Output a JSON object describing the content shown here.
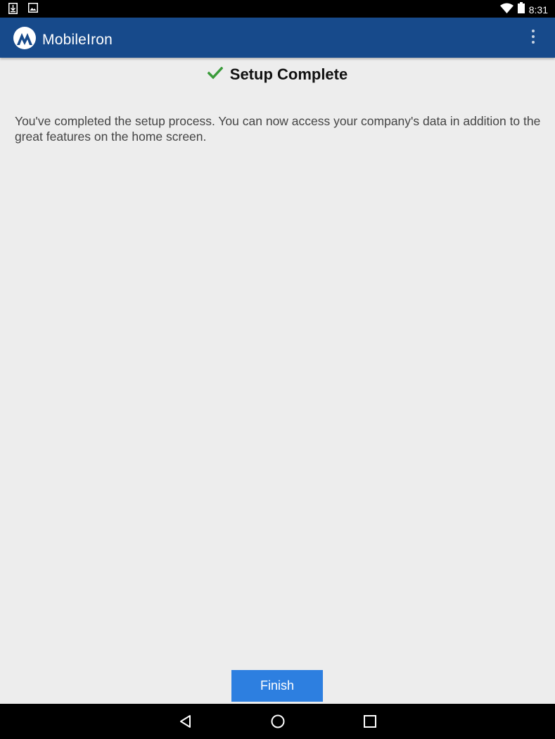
{
  "status_bar": {
    "time": "8:31",
    "icons": [
      "download-icon",
      "image-icon",
      "wifi-icon",
      "battery-icon"
    ]
  },
  "app_bar": {
    "title": "MobileIron",
    "logo_icon": "mobileiron-logo-icon",
    "menu_icon": "overflow-menu-icon",
    "color": "#174a8b"
  },
  "main": {
    "heading": "Setup Complete",
    "heading_icon": "checkmark-icon",
    "check_color": "#3a9b3a",
    "message": "You've completed the setup process. You can now access your company's data in addition to the great features on the home screen."
  },
  "footer": {
    "finish_label": "Finish",
    "button_color": "#2d7fe0"
  },
  "nav_bar": {
    "icons": [
      "back-icon",
      "home-icon",
      "recents-icon"
    ]
  }
}
